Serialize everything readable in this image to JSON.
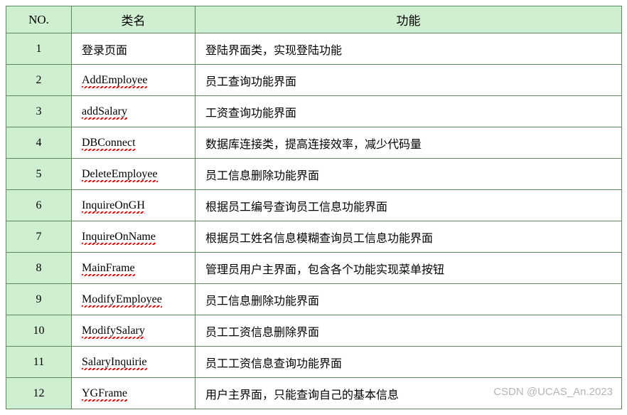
{
  "chart_data": {
    "type": "table",
    "columns": [
      "NO.",
      "类名",
      "功能"
    ],
    "rows": [
      {
        "no": "1",
        "name": "登录页面",
        "name_spell": false,
        "func": "登陆界面类，实现登陆功能"
      },
      {
        "no": "2",
        "name": "AddEmployee",
        "name_spell": true,
        "func": "员工查询功能界面"
      },
      {
        "no": "3",
        "name": "addSalary",
        "name_spell": true,
        "func": "工资查询功能界面"
      },
      {
        "no": "4",
        "name": "DBConnect",
        "name_spell": true,
        "func": "数据库连接类，提高连接效率，减少代码量"
      },
      {
        "no": "5",
        "name": "DeleteEmployee",
        "name_spell": true,
        "func": "员工信息删除功能界面"
      },
      {
        "no": "6",
        "name": "InquireOnGH",
        "name_spell": true,
        "func": "根据员工编号查询员工信息功能界面"
      },
      {
        "no": "7",
        "name": "InquireOnName",
        "name_spell": true,
        "func": "根据员工姓名信息模糊查询员工信息功能界面"
      },
      {
        "no": "8",
        "name": "MainFrame",
        "name_spell": true,
        "func": "管理员用户主界面，包含各个功能实现菜单按钮"
      },
      {
        "no": "9",
        "name": "ModifyEmployee",
        "name_spell": true,
        "func": "员工信息删除功能界面"
      },
      {
        "no": "10",
        "name": "ModifySalary",
        "name_spell": true,
        "func": "员工工资信息删除界面"
      },
      {
        "no": "11",
        "name": "SalaryInquirie",
        "name_spell": true,
        "func": "员工工资信息查询功能界面"
      },
      {
        "no": "12",
        "name": "YGFrame",
        "name_spell": true,
        "func": "用户主界面，只能查询自己的基本信息"
      }
    ]
  },
  "watermark": "CSDN @UCAS_An.2023"
}
